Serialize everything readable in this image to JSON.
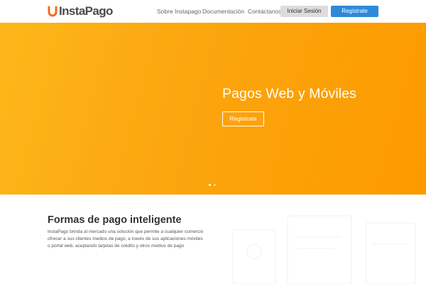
{
  "header": {
    "logo_text": "InstaPago",
    "nav": [
      "Sobre Instapago",
      "Documentación",
      "Contáctanos"
    ],
    "login_label": "Iniciar Sesión",
    "register_label": "Registrate"
  },
  "hero": {
    "title": "Pagos Web y Móviles",
    "cta_label": "Registrate",
    "slides_total": 2,
    "active_slide": 1
  },
  "section": {
    "title": "Formas de pago inteligente",
    "description": "InstaPago brinda al mercado una solución que permite a cualquier comercio ofrecer a sus clientes medios de pago, a través de sus aplicaciones móviles o portal web, aceptando tarjetas de crédito y otros medios de pago"
  },
  "colors": {
    "brand_orange": "#fca50e",
    "primary_blue": "#2f89d8",
    "logo_accent": "#f26a21"
  }
}
